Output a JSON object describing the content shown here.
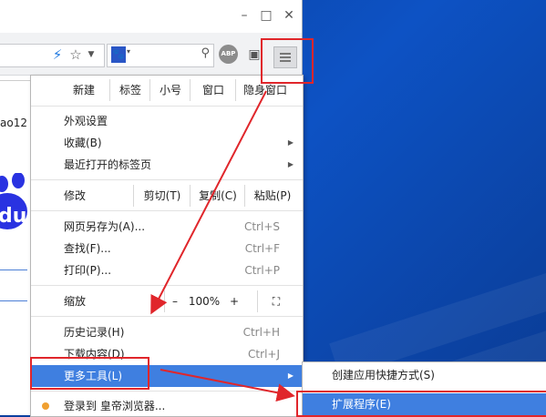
{
  "window": {
    "minimize": "–",
    "maximize": "□",
    "close": "✕"
  },
  "page": {
    "partial_text": "ao12",
    "baidu_text": "du"
  },
  "menu": {
    "row1": {
      "new": "新建",
      "tab": "标签",
      "small": "小号",
      "window": "窗口",
      "incognito": "隐身窗口"
    },
    "appearance": "外观设置",
    "bookmarks": "收藏(B)",
    "recent_tabs": "最近打开的标签页",
    "edit": {
      "label": "修改",
      "cut": "剪切(T)",
      "copy": "复制(C)",
      "paste": "粘贴(P)"
    },
    "save_as": {
      "label": "网页另存为(A)...",
      "shortcut": "Ctrl+S"
    },
    "find": {
      "label": "查找(F)...",
      "shortcut": "Ctrl+F"
    },
    "print": {
      "label": "打印(P)...",
      "shortcut": "Ctrl+P"
    },
    "zoom": {
      "label": "缩放",
      "minus": "–",
      "value": "100%",
      "plus": "+",
      "fullscreen": "⛶"
    },
    "history": {
      "label": "历史记录(H)",
      "shortcut": "Ctrl+H"
    },
    "downloads": {
      "label": "下载内容(D)",
      "shortcut": "Ctrl+J"
    },
    "more_tools": "更多工具(L)",
    "login": "登录到 皇帝浏览器..."
  },
  "submenu": {
    "create_shortcut": "创建应用快捷方式(S)",
    "extensions": "扩展程序(E)"
  },
  "colors": {
    "highlight": "#3f7fe0",
    "annotation": "#e0262b",
    "desktop": "#0d52c4"
  }
}
